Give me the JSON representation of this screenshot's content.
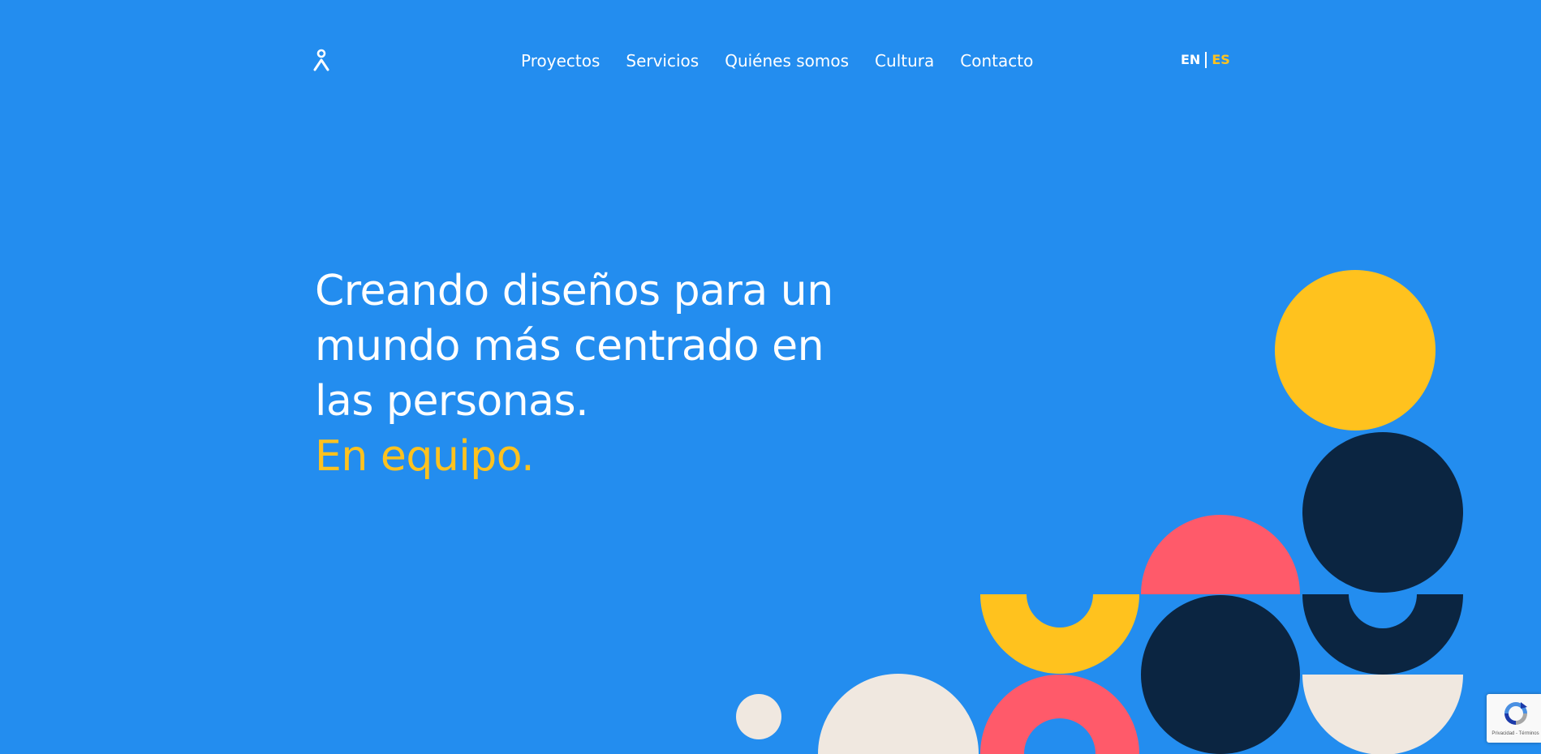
{
  "colors": {
    "background": "#238DEF",
    "text": "#FFFFFF",
    "accent_yellow": "#FFC21E",
    "navy": "#0B2541",
    "coral": "#FF5A6A",
    "cream": "#F0E8E0"
  },
  "header": {
    "logo_icon": "person-figure-logo",
    "nav": [
      {
        "label": "Proyectos"
      },
      {
        "label": "Servicios"
      },
      {
        "label": "Quiénes somos"
      },
      {
        "label": "Cultura"
      },
      {
        "label": "Contacto"
      }
    ],
    "languages": {
      "en": "EN",
      "es": "ES",
      "active": "ES"
    }
  },
  "hero": {
    "line1": "Creando diseños para un",
    "line2": "mundo más centrado en",
    "line3": "las personas.",
    "accent": "En equipo."
  },
  "recaptcha": {
    "icon": "recaptcha-icon",
    "text": "Privacidad - Términos"
  }
}
